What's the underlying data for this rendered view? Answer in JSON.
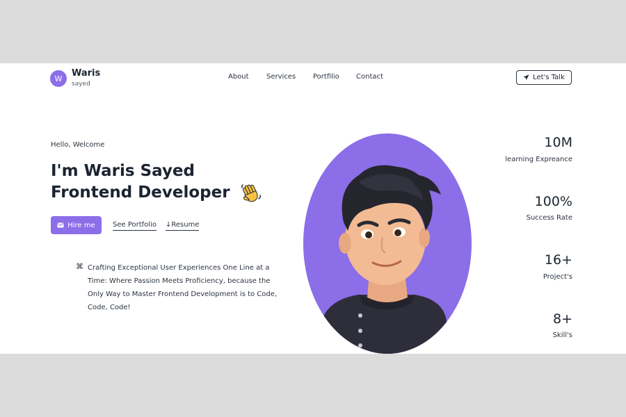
{
  "brand": {
    "initial": "W",
    "name": "Waris",
    "subtitle": "sayed"
  },
  "nav": {
    "items": [
      "About",
      "Services",
      "Portfilio",
      "Contact"
    ]
  },
  "header": {
    "cta_label": "Let's Talk"
  },
  "hero": {
    "greeting": "Hello, Welcome",
    "headline_line1": "I'm Waris Sayed",
    "headline_line2": "Frontend Developer",
    "hire_label": "Hire me",
    "portfolio_label": "See Portfolio",
    "resume_label": "Resume",
    "tagline": "Crafting Exceptional User Experiences One Line at a Time: Where Passion Meets Proficiency, because the Only Way to Master Frontend Development is to Code, Code, Code!"
  },
  "stats": [
    {
      "value": "10M",
      "label": "learning Expreance"
    },
    {
      "value": "100%",
      "label": "Success Rate"
    },
    {
      "value": "16+",
      "label": "Project's"
    },
    {
      "value": "8+",
      "label": "Skill's"
    }
  ],
  "colors": {
    "accent": "#8b6ee8",
    "text": "#1b2430",
    "outer_background": "#dcdcdc",
    "page_background": "#ffffff"
  },
  "icons": {
    "send": "send-icon",
    "mail": "mail-icon",
    "download": "download-arrow-icon",
    "command": "command-icon",
    "wave": "waving-hand-icon"
  }
}
